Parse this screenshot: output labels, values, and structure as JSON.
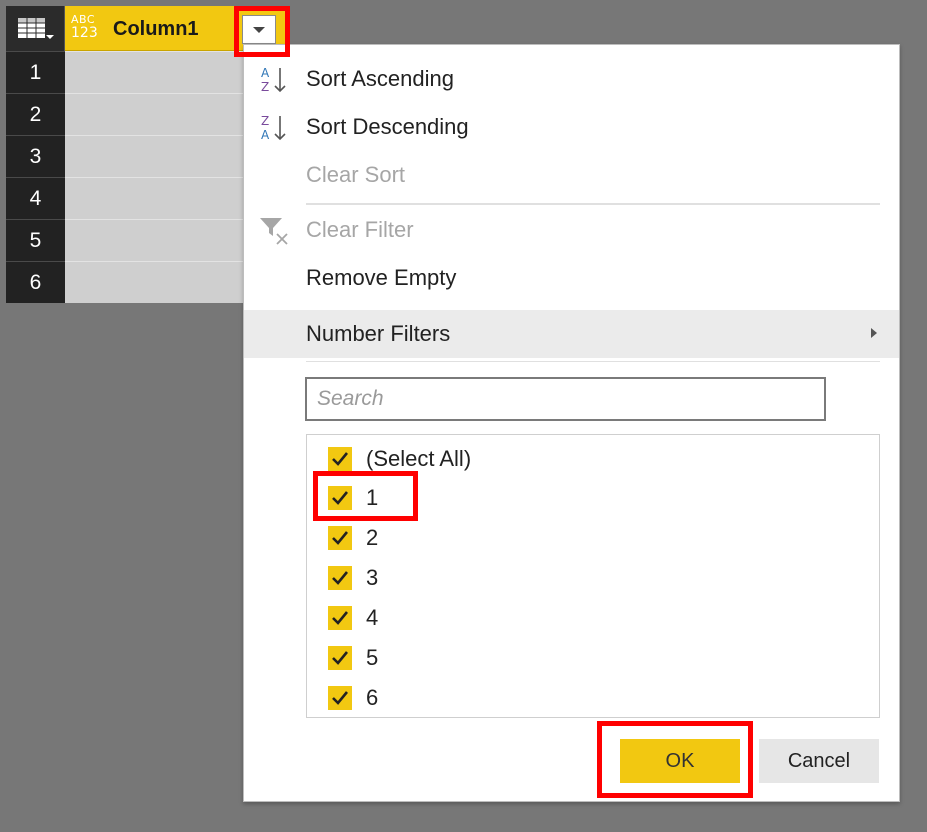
{
  "grid": {
    "column_header": {
      "type_icon_top": "ABC",
      "type_icon_bottom": "123",
      "name": "Column1"
    },
    "rows": [
      "1",
      "2",
      "3",
      "4",
      "5",
      "6"
    ]
  },
  "menu": {
    "sort_ascending": "Sort Ascending",
    "sort_descending": "Sort Descending",
    "clear_sort": "Clear Sort",
    "clear_filter": "Clear Filter",
    "remove_empty": "Remove Empty",
    "number_filters": "Number Filters",
    "search": {
      "placeholder": "Search",
      "value": ""
    },
    "list": [
      {
        "label": "(Select All)",
        "checked": true
      },
      {
        "label": "1",
        "checked": true
      },
      {
        "label": "2",
        "checked": true
      },
      {
        "label": "3",
        "checked": true
      },
      {
        "label": "4",
        "checked": true
      },
      {
        "label": "5",
        "checked": true
      },
      {
        "label": "6",
        "checked": true
      }
    ],
    "ok_label": "OK",
    "cancel_label": "Cancel"
  },
  "colors": {
    "accent": "#f2c811",
    "highlight": "#ff0000",
    "background": "#777777"
  }
}
